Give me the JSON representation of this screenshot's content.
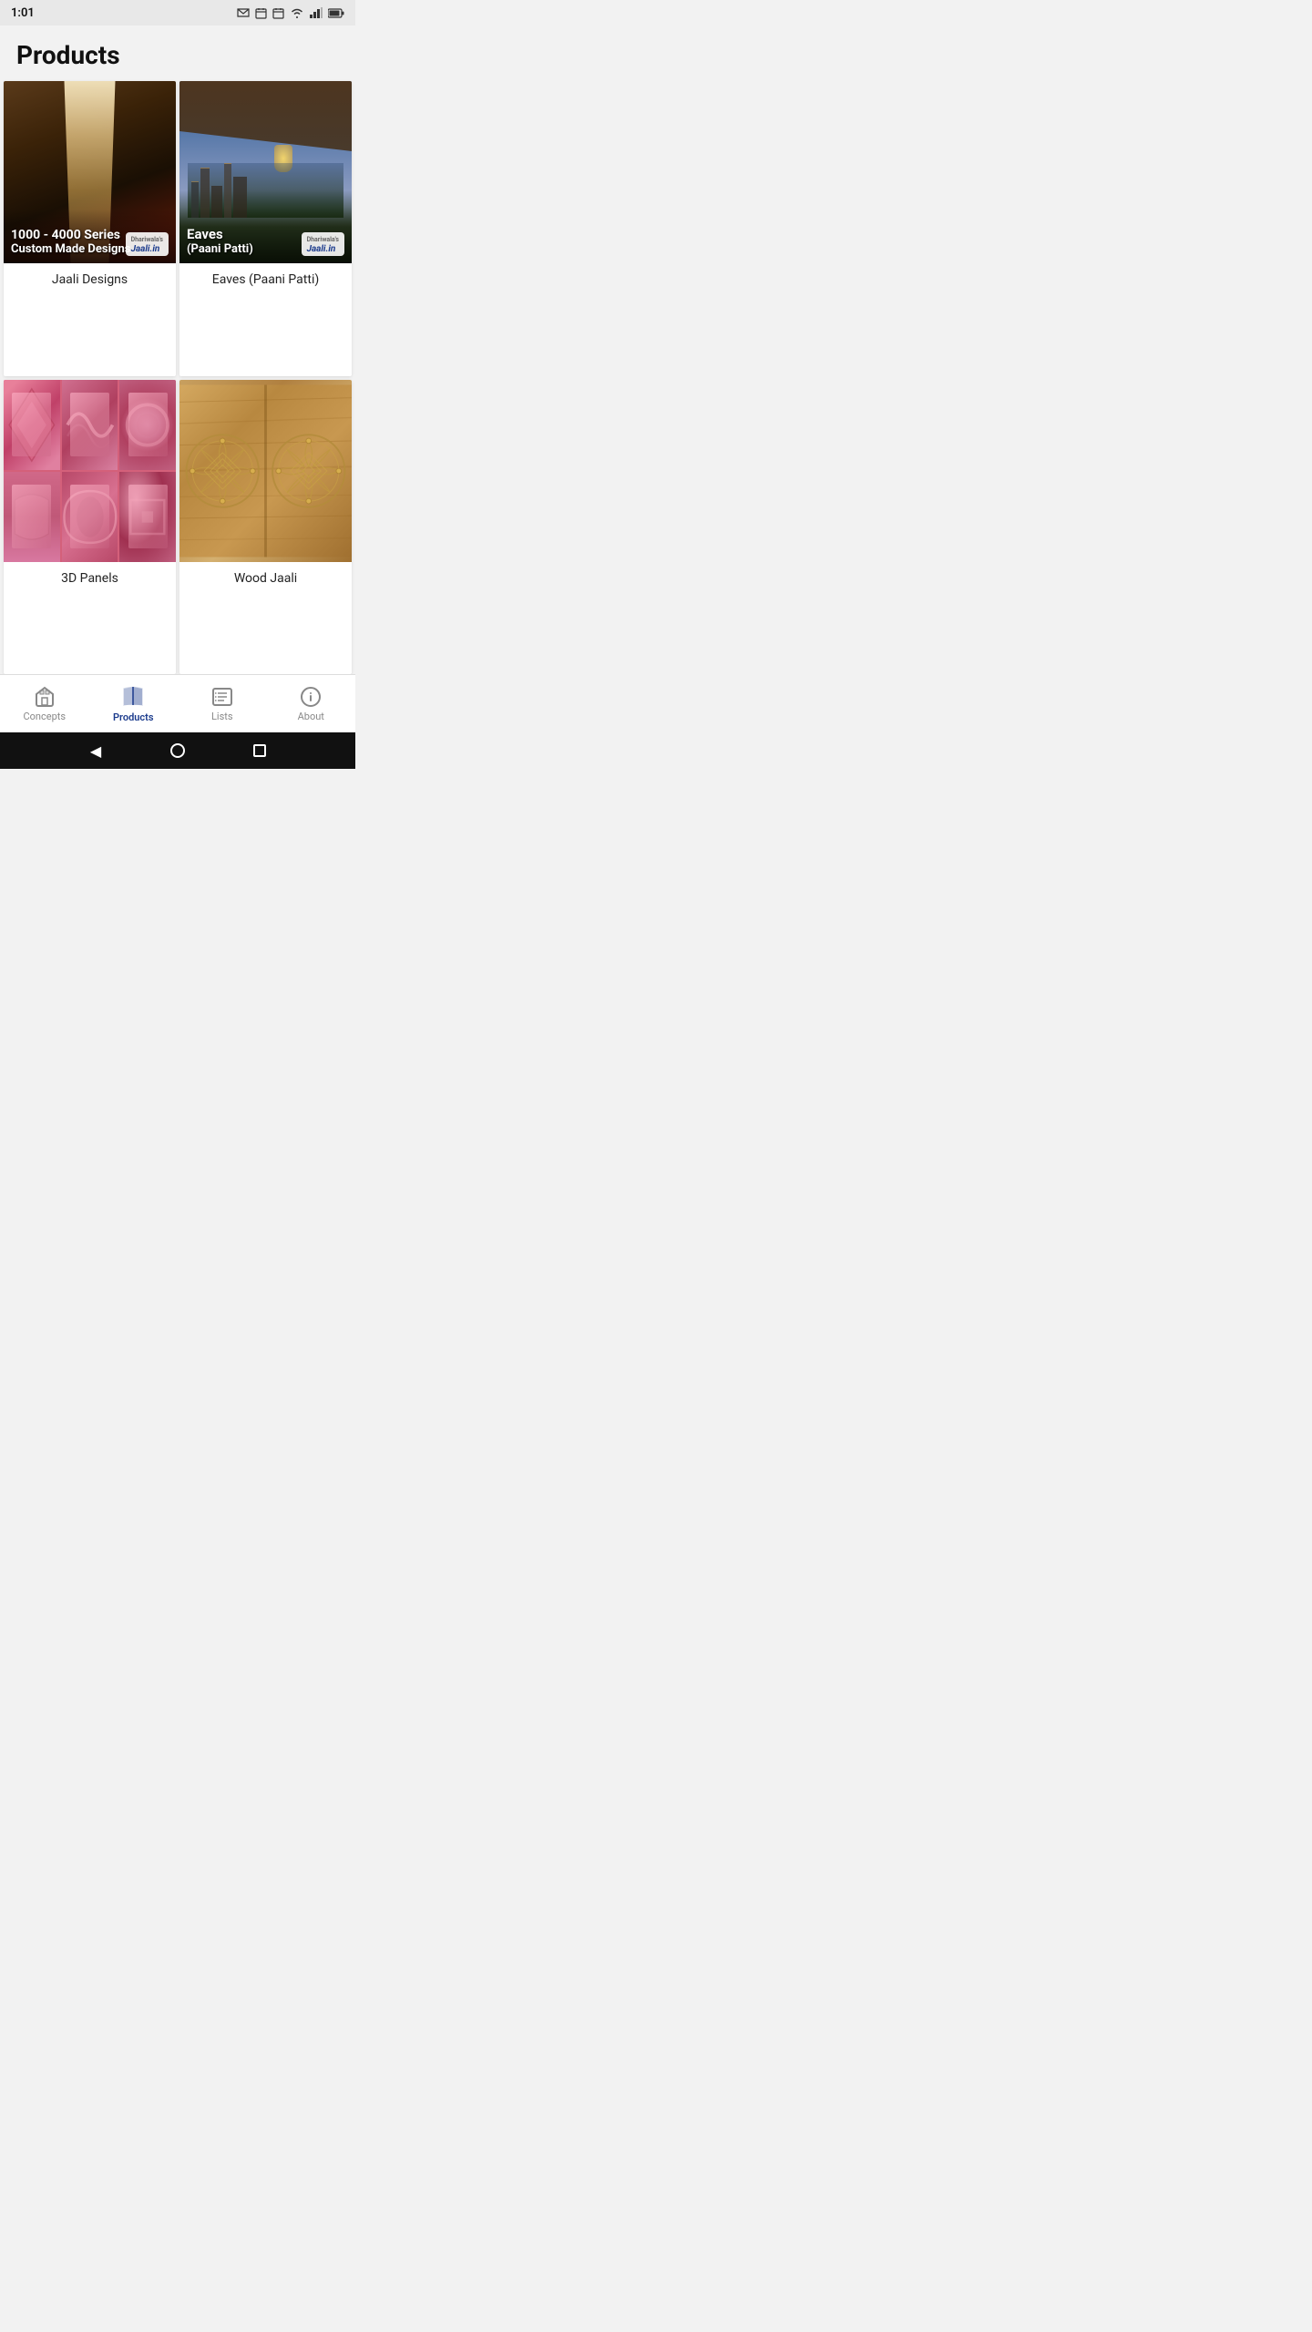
{
  "statusBar": {
    "time": "1:01",
    "icons": [
      "gmail",
      "calendar",
      "calendar2",
      "wifi",
      "signal",
      "battery"
    ]
  },
  "pageTitle": "Products",
  "products": [
    {
      "id": "jaali-designs",
      "imageType": "jaali",
      "overlayText1": "1000 - 4000 Series",
      "overlayText2": "Custom Made Designs",
      "logoText": "Jaali.in",
      "label": "Jaali Designs"
    },
    {
      "id": "eaves-paani-patti",
      "imageType": "eaves",
      "overlayText1": "Eaves",
      "overlayText2": "(Paani Patti)",
      "logoText": "Jaali.in",
      "label": "Eaves (Paani Patti)"
    },
    {
      "id": "3d-panels",
      "imageType": "3dpanels",
      "label": "3D Panels"
    },
    {
      "id": "wood-jaali",
      "imageType": "woodjaali",
      "label": "Wood Jaali"
    }
  ],
  "bottomNav": {
    "items": [
      {
        "id": "concepts",
        "label": "Concepts",
        "icon": "🏠",
        "active": false
      },
      {
        "id": "products",
        "label": "Products",
        "icon": "📖",
        "active": true
      },
      {
        "id": "lists",
        "label": "Lists",
        "icon": "📋",
        "active": false
      },
      {
        "id": "about",
        "label": "About",
        "icon": "ℹ️",
        "active": false
      }
    ]
  }
}
